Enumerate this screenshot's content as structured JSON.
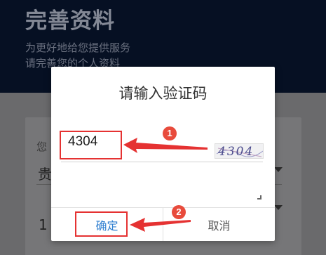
{
  "background": {
    "title": "完善资料",
    "subtitle_line1": "为更好地给您提供服务",
    "subtitle_line2": "请完善您的个人资料",
    "field_label": "您",
    "field_value1": "贵",
    "field_value2": "1"
  },
  "dialog": {
    "title": "请输入验证码",
    "captcha_input_value": "4304",
    "captcha_image_text": "4304",
    "confirm_label": "确定",
    "cancel_label": "取消"
  },
  "annotations": {
    "step1": "1",
    "step2": "2",
    "highlight_color": "#e53232"
  }
}
